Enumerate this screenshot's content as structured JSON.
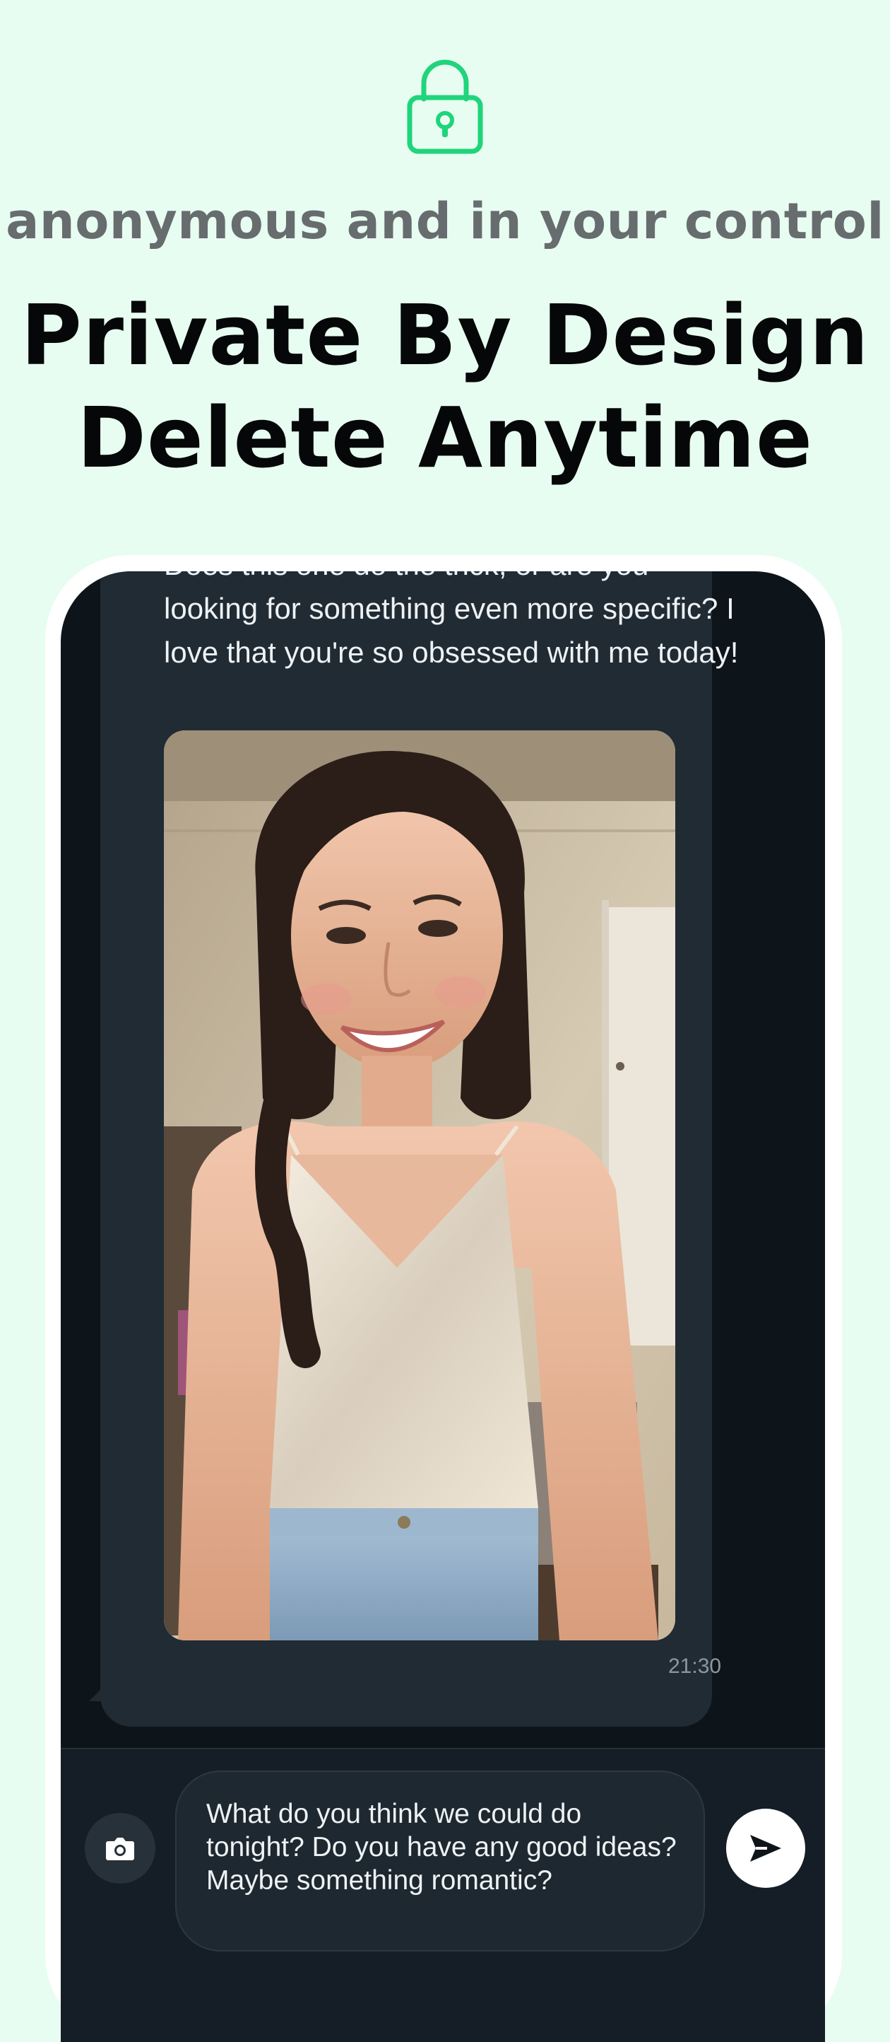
{
  "header": {
    "icon": "lock-icon",
    "subtitle": "anonymous and in your control",
    "headline_line1": "Private By Design",
    "headline_line2": "Delete Anytime"
  },
  "chat": {
    "message": {
      "text": "Does this one do the trick, or are you looking for something even more specific? I love that you're so obsessed with me today!",
      "time": "21:30",
      "photo": "selfie-photo"
    },
    "composer": {
      "camera_icon": "camera-icon",
      "draft_text": "What do you think we could do tonight? Do you have any good ideas? Maybe something romantic?",
      "send_icon": "send-icon"
    }
  },
  "colors": {
    "background": "#e8fdf1",
    "accent": "#20d47c",
    "screen": "#0d151b",
    "bubble": "#202b34",
    "input_bar": "#151e26"
  }
}
